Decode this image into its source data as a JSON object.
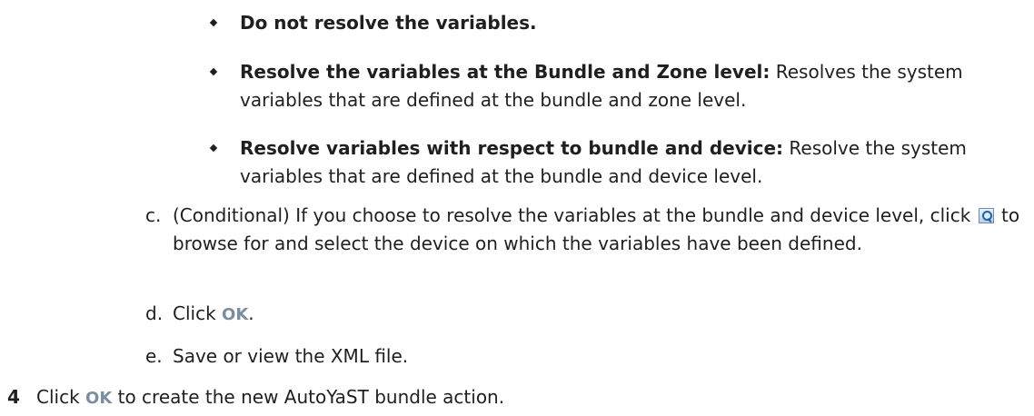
{
  "bullets": [
    {
      "bold": "Do not resolve the variables.",
      "rest": ""
    },
    {
      "bold": "Resolve the variables at the Bundle and Zone level:",
      "rest": " Resolves the system variables that are defined at the bundle and zone level."
    },
    {
      "bold": "Resolve variables with respect to bundle and device:",
      "rest": " Resolve the system variables that are defined at the bundle and device level."
    }
  ],
  "steps": {
    "c": {
      "marker": "c.",
      "before_icon": "(Conditional) If you choose to resolve the variables at the bundle and device level, click ",
      "icon": "browse-icon",
      "after_icon": " to browse for and select the device on which the variables have been defined."
    },
    "d": {
      "marker": "d.",
      "before": "Click ",
      "ok": "OK",
      "after": "."
    },
    "e": {
      "marker": "e.",
      "text": "Save or view the XML file."
    }
  },
  "main_step": {
    "number": "4",
    "before": "Click ",
    "ok": "OK",
    "after": " to create the new AutoYaST bundle action."
  },
  "colors": {
    "ok_link": "#7a8ea0",
    "text": "#1f1f1f"
  }
}
